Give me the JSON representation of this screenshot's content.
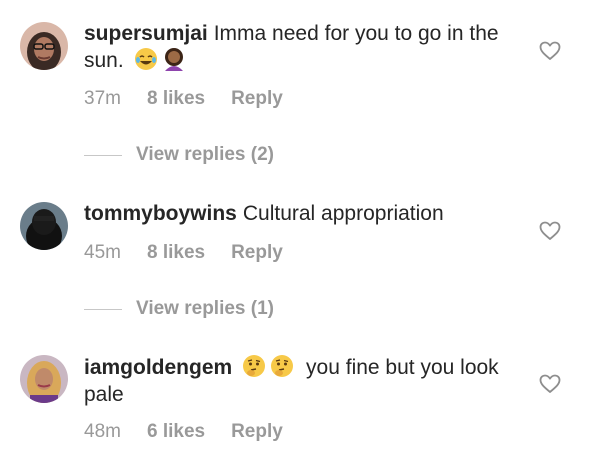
{
  "comments": [
    {
      "username": "supersumjai",
      "text": "Imma need for you to go in the sun.",
      "emoji": [
        "face-with-tears-of-joy-emoji",
        "woman-gesturing-emoji"
      ],
      "time": "37m",
      "likes": "8 likes",
      "reply": "Reply",
      "view_replies": "View replies (2)"
    },
    {
      "username": "tommyboywins",
      "text": "Cultural appropriation",
      "time": "45m",
      "likes": "8 likes",
      "reply": "Reply",
      "view_replies": "View replies (1)"
    },
    {
      "username": "iamgoldengem",
      "emoji": [
        "thinking-face-emoji",
        "thinking-face-emoji"
      ],
      "text": "you fine but you look pale",
      "time": "48m",
      "likes": "6 likes",
      "reply": "Reply"
    }
  ],
  "colors": {
    "text": "#262626",
    "meta": "#999999",
    "line": "#c7c7c7"
  }
}
